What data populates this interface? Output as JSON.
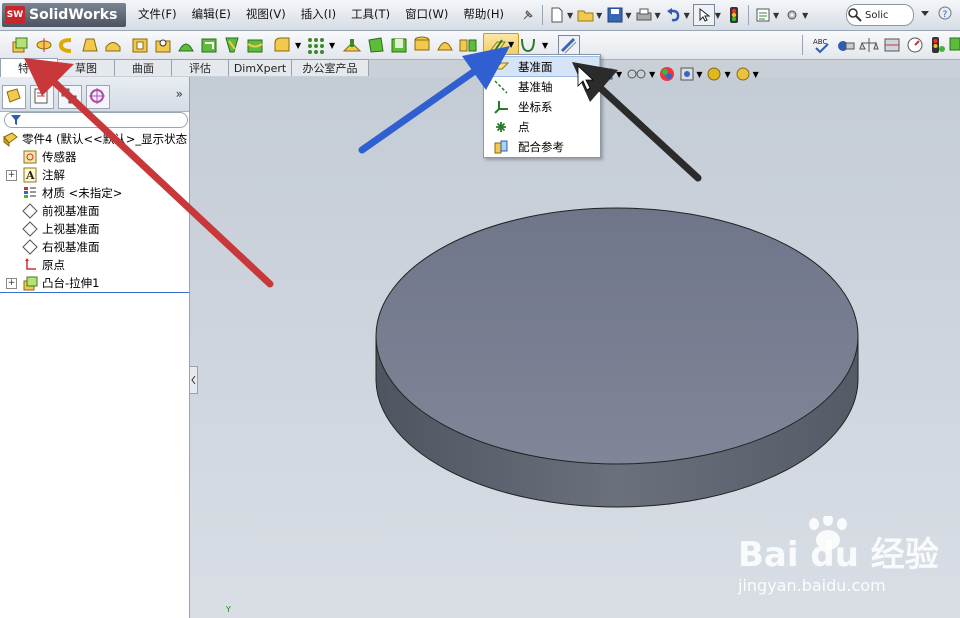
{
  "app": {
    "title": "SolidWorks",
    "logo_badge": "SW"
  },
  "menu": {
    "items": [
      "文件(F)",
      "编辑(E)",
      "视图(V)",
      "插入(I)",
      "工具(T)",
      "窗口(W)",
      "帮助(H)"
    ],
    "search_value": "Solic"
  },
  "tabs": [
    "特征",
    "草图",
    "曲面",
    "评估",
    "DimXpert",
    "办公室产品"
  ],
  "active_tab": "特征",
  "tree": {
    "root": "零件4   (默认<<默认>_显示状态",
    "items": [
      "传感器",
      "注解",
      "材质 <未指定>",
      "前视基准面",
      "上视基准面",
      "右视基准面",
      "原点",
      "凸台-拉伸1"
    ]
  },
  "reference_menu": {
    "items": [
      "基准面",
      "基准轴",
      "坐标系",
      "点",
      "配合参考"
    ],
    "highlighted": "基准面"
  },
  "watermark": {
    "brand": "Bai du 经验",
    "url": "jingyan.baidu.com"
  },
  "colors": {
    "arrow_red": "#c8383a",
    "arrow_blue": "#2f5fd0",
    "arrow_black": "#2b2b2b",
    "model_face": "#7a808f",
    "model_side": "#5d636f"
  },
  "axis_label": "Y"
}
